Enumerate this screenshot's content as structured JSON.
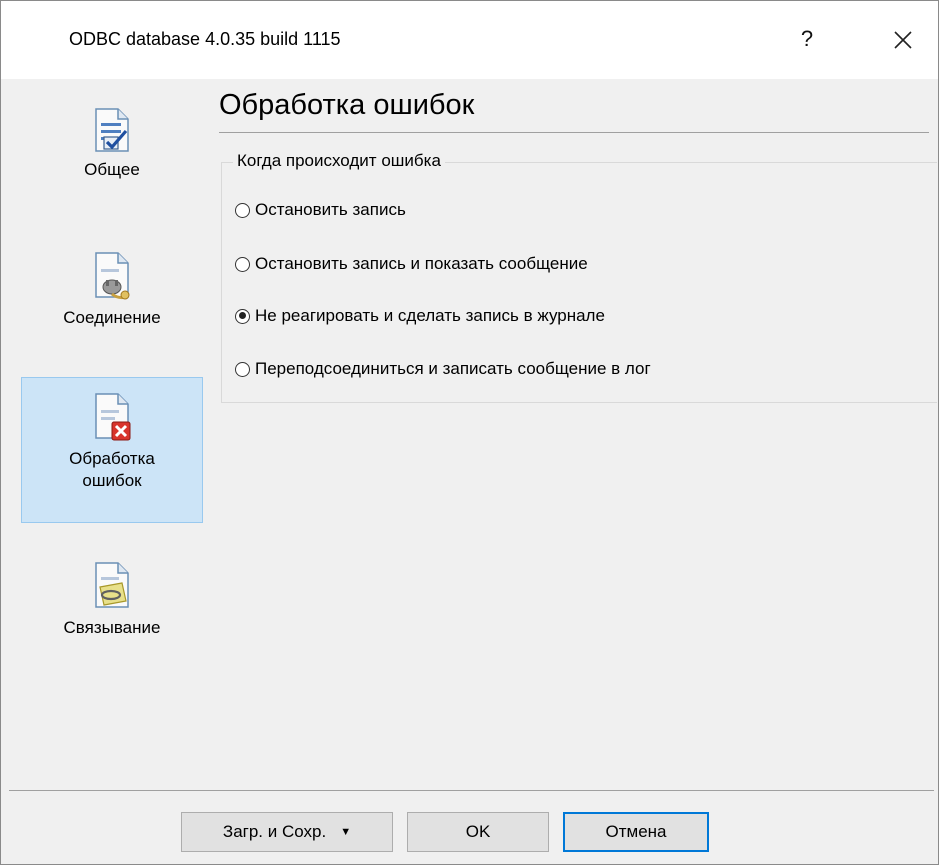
{
  "window": {
    "title": "ODBC database 4.0.35 build 1115",
    "help_glyph": "?",
    "close_glyph": "✕"
  },
  "sidebar": {
    "items": [
      {
        "label": "Общее",
        "icon": "document-check-icon"
      },
      {
        "label": "Соединение",
        "icon": "document-plug-icon"
      },
      {
        "label": "Обработка ошибок",
        "icon": "document-error-icon",
        "selected": true
      },
      {
        "label": "Связывание",
        "icon": "document-link-icon"
      }
    ]
  },
  "main": {
    "title": "Обработка ошибок",
    "group_label": "Когда происходит ошибка",
    "options": [
      {
        "label": "Остановить запись",
        "checked": false
      },
      {
        "label": "Остановить запись и показать сообщение",
        "checked": false
      },
      {
        "label": "Не реагировать и сделать запись в журнале",
        "checked": true
      },
      {
        "label": "Переподсоединиться и записать сообщение в лог",
        "checked": false
      }
    ]
  },
  "footer": {
    "load_save_label": "Загр. и Сохр.",
    "load_save_arrow": "▼",
    "ok_label": "OK",
    "cancel_label": "Отмена"
  },
  "colors": {
    "selection_bg": "#cce4f7",
    "selection_border": "#99c9ef",
    "accent": "#0078d7"
  }
}
